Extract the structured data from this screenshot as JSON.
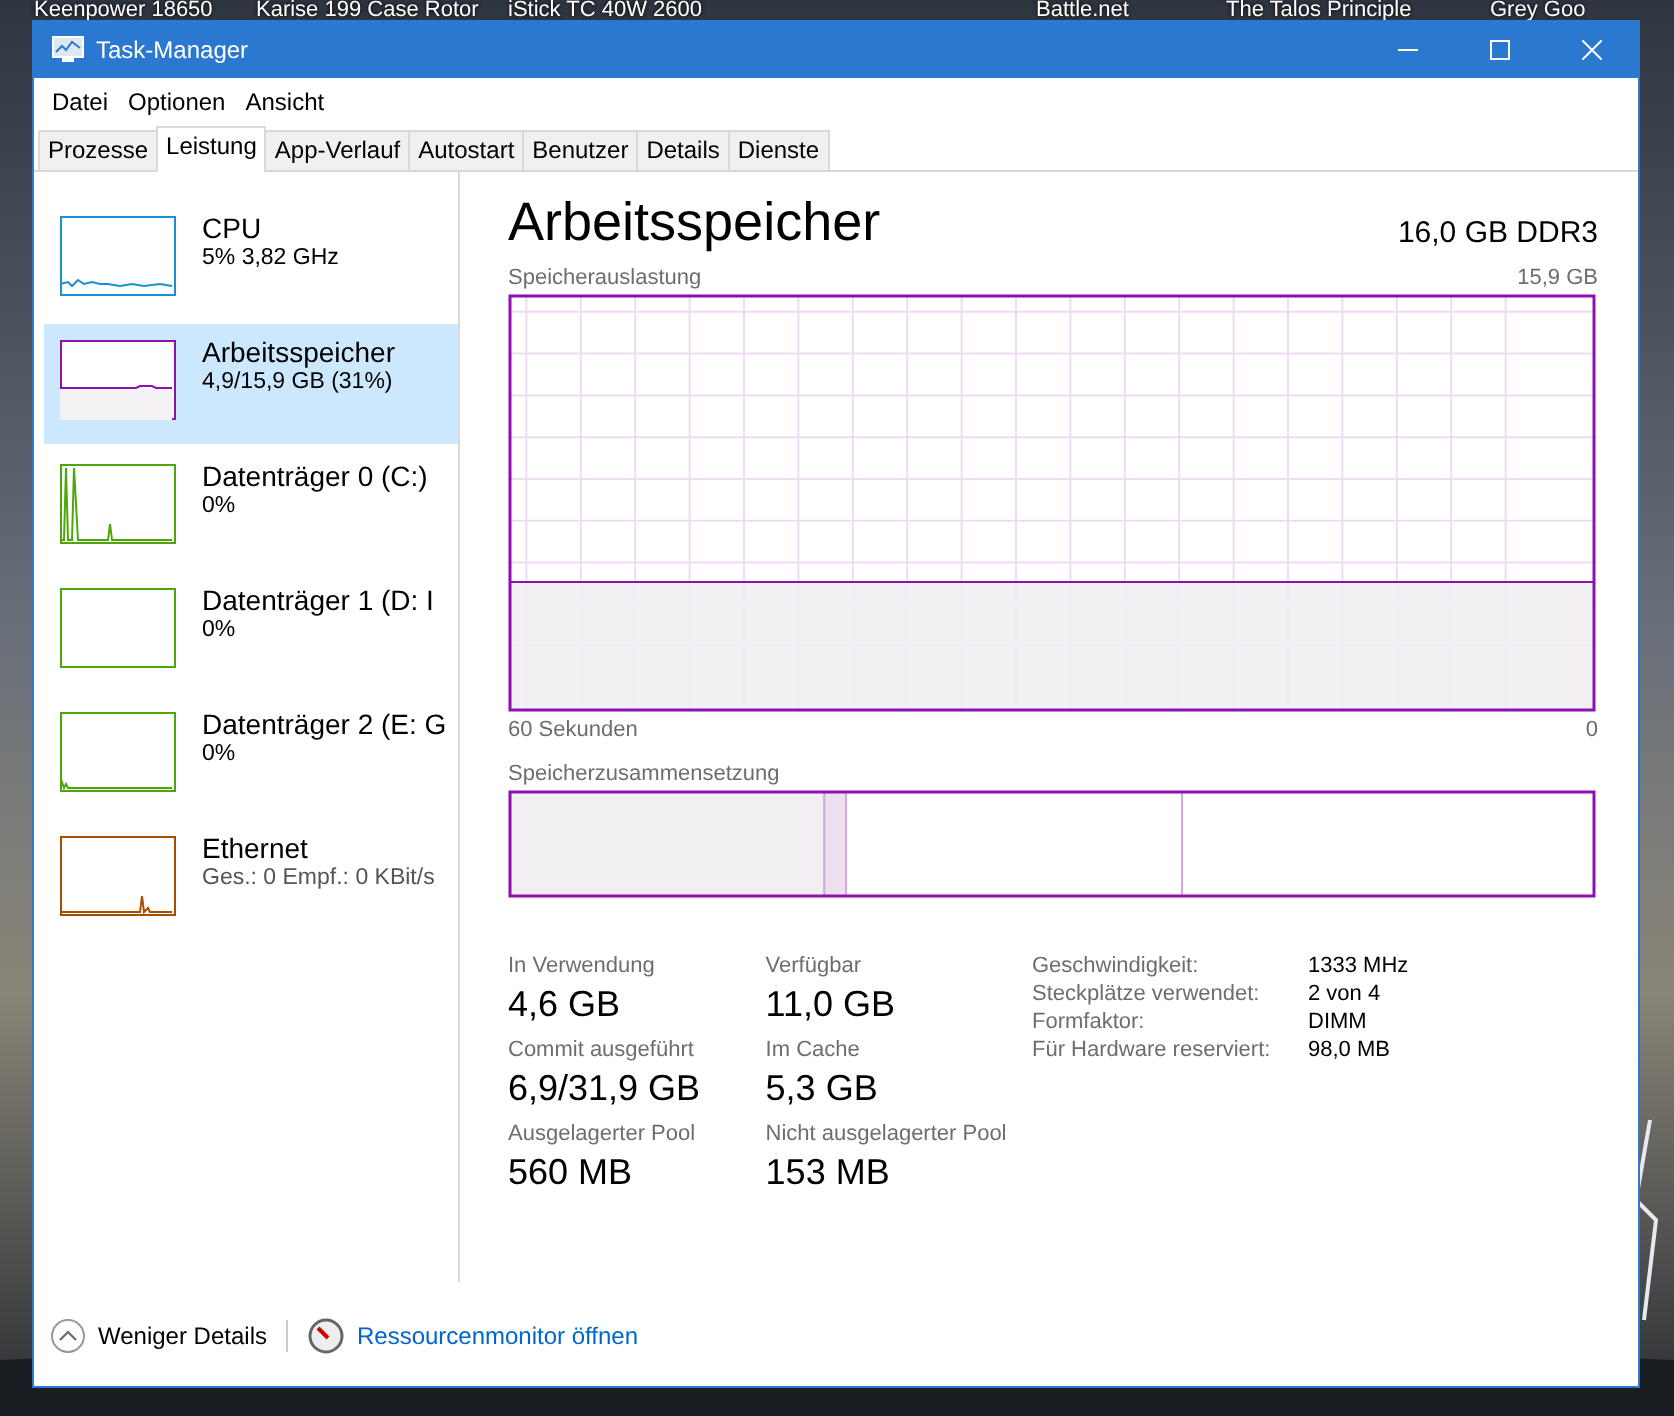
{
  "desktop": {
    "labels": [
      {
        "text": "Keenpower 18650"
      },
      {
        "text": "Karise 199 Case Rotor"
      },
      {
        "text": "iStick TC 40W 2600"
      },
      {
        "text": "Battle.net"
      },
      {
        "text": "The Talos Principle"
      },
      {
        "text": "Grey Goo"
      }
    ]
  },
  "window": {
    "title": "Task-Manager"
  },
  "menu": [
    "Datei",
    "Optionen",
    "Ansicht"
  ],
  "tabs": [
    {
      "label": "Prozesse",
      "selected": false
    },
    {
      "label": "Leistung",
      "selected": true
    },
    {
      "label": "App-Verlauf",
      "selected": false
    },
    {
      "label": "Autostart",
      "selected": false
    },
    {
      "label": "Benutzer",
      "selected": false
    },
    {
      "label": "Details",
      "selected": false
    },
    {
      "label": "Dienste",
      "selected": false
    }
  ],
  "sidebar": {
    "items": [
      {
        "kind": "cpu",
        "title": "CPU",
        "subtitle": "5% 3,82 GHz",
        "color": "#1b8fd1",
        "selected": false
      },
      {
        "kind": "memory",
        "title": "Arbeitsspeicher",
        "subtitle": "4,9/15,9 GB (31%)",
        "color": "#8b12ae",
        "selected": true
      },
      {
        "kind": "disk-busy",
        "title": "Datenträger 0 (C:)",
        "subtitle": "0%",
        "color": "#4da60c",
        "selected": false
      },
      {
        "kind": "disk",
        "title": "Datenträger 1 (D: I",
        "subtitle": "0%",
        "color": "#4da60c",
        "selected": false
      },
      {
        "kind": "disk-low",
        "title": "Datenträger 2 (E: G",
        "subtitle": "0%",
        "color": "#4da60c",
        "selected": false
      },
      {
        "kind": "network",
        "title": "Ethernet",
        "subtitle": "Ges.: 0 Empf.: 0 KBit/s",
        "color": "#a74f01",
        "selected": false
      }
    ]
  },
  "detail": {
    "title": "Arbeitsspeicher",
    "capacity": "16,0 GB DDR3",
    "usage_graph": {
      "label": "Speicherauslastung",
      "max": "15,9 GB",
      "x_start": "60 Sekunden",
      "x_end": "0"
    },
    "composition": {
      "label": "Speicherzusammensetzung"
    },
    "stats": [
      [
        {
          "label": "In Verwendung",
          "value": "4,6 GB"
        },
        {
          "label": "Verfügbar",
          "value": "11,0 GB"
        }
      ],
      [
        {
          "label": "Commit ausgeführt",
          "value": "6,9/31,9 GB"
        },
        {
          "label": "Im Cache",
          "value": "5,3 GB"
        }
      ],
      [
        {
          "label": "Ausgelagerter Pool",
          "value": "560 MB"
        },
        {
          "label": "Nicht ausgelagerter Pool",
          "value": "153 MB"
        }
      ]
    ],
    "properties": [
      {
        "label": "Geschwindigkeit:",
        "value": "1333 MHz"
      },
      {
        "label": "Steckplätze verwendet:",
        "value": "2 von 4"
      },
      {
        "label": "Formfaktor:",
        "value": "DIMM"
      },
      {
        "label": "Für Hardware reserviert:",
        "value": "98,0 MB"
      }
    ]
  },
  "footer": {
    "toggle": "Weniger Details",
    "link": "Ressourcenmonitor öffnen"
  }
}
